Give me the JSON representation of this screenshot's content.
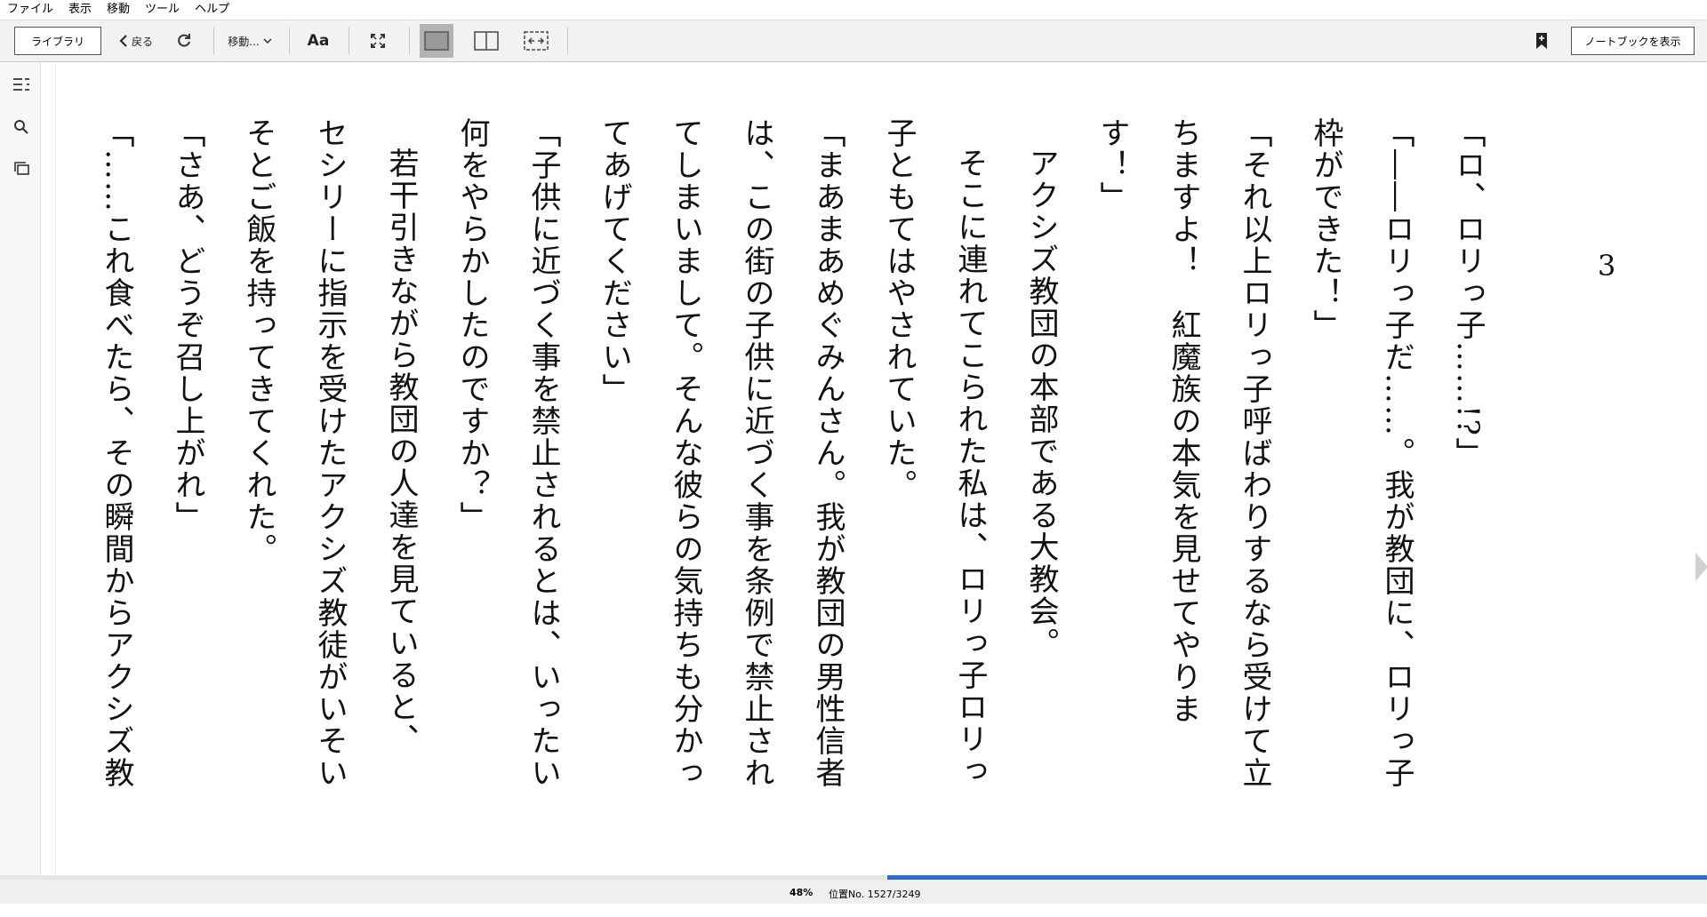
{
  "menu": [
    "ファイル",
    "表示",
    "移動",
    "ツール",
    "ヘルプ"
  ],
  "toolbar": {
    "library_label": "ライブラリ",
    "back_label": "戻る",
    "goto_label": "移動...",
    "font_label": "Aa",
    "notebook_label": "ノートブックを表示"
  },
  "page": {
    "number": "3",
    "lines": [
      "「ロ、ロリっ子……!?」",
      "「――ロリっ子だ……。我が教団に、ロリっ子",
      "枠ができた！」",
      "「それ以上ロリっ子呼ばわりするなら受けて立",
      "ちますよ！　紅魔族の本気を見せてやりま",
      "す！」",
      "アクシズ教団の本部である大教会。",
      "そこに連れてこられた私は、ロリっ子ロリっ",
      "子ともてはやされていた。",
      "「まあまあめぐみんさん。我が教団の男性信者",
      "は、この街の子供に近づく事を条例で禁止され",
      "てしまいまして。そんな彼らの気持ちも分かっ",
      "てあげてください」",
      "「子供に近づく事を禁止されるとは、いったい",
      "何をやらかしたのですか？」",
      "若干引きながら教団の人達を見ていると、",
      "セシリーに指示を受けたアクシズ教徒がいそい",
      "そとご飯を持ってきてくれた。",
      "「さあ、どうぞ召し上がれ」",
      "「……これ食べたら、その瞬間からアクシズ教"
    ]
  },
  "status": {
    "percent_label": "48%",
    "location_label": "位置No. 1527/3249",
    "progress": 0.48
  },
  "colors": {
    "progress": "#2f6fbf",
    "toolbar_bg": "#f2f2f2"
  }
}
